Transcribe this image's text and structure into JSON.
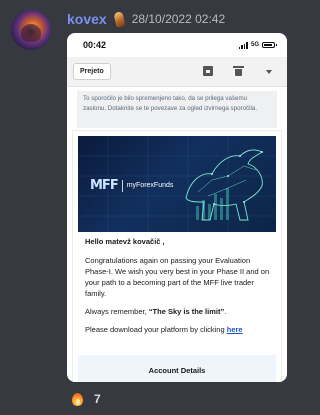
{
  "message": {
    "username": "kovex",
    "timestamp": "28/10/2022 02:42"
  },
  "phone": {
    "status_bar": {
      "time": "00:42",
      "network": "5G"
    },
    "toolbar": {
      "received_label": "Prejeto",
      "icons": [
        "archive-icon",
        "trash-icon",
        "caret-down-icon"
      ]
    },
    "notice": "To sporočilo je bilo spremenjeno tako, da se prilega vašemu zaslonu. Dotaknite se te povezave za ogled izvirnega sporočila.",
    "email": {
      "banner_logo_mark": "MFF",
      "banner_logo_text": "myForexFunds",
      "greeting": "Hello matevž kovačič ,",
      "paragraph_1": "Congratulations again on passing your Evaluation Phase-I. We wish you very best in your Phase II and on your path to a becoming part of the MFF live trader family.",
      "paragraph_2_prefix": "Always remember, ",
      "paragraph_2_quote": "“The Sky is the limit”",
      "paragraph_2_suffix": ".",
      "paragraph_3_prefix": "Please download your platform by clicking ",
      "paragraph_3_link": "here",
      "account_details_title": "Account Details"
    }
  },
  "reaction": {
    "emoji": "fire-icon",
    "count": "7"
  },
  "colors": {
    "background": "#36393f",
    "username": "#7d8ff0",
    "banner": "#0b1a3c",
    "link": "#1a56c9"
  }
}
